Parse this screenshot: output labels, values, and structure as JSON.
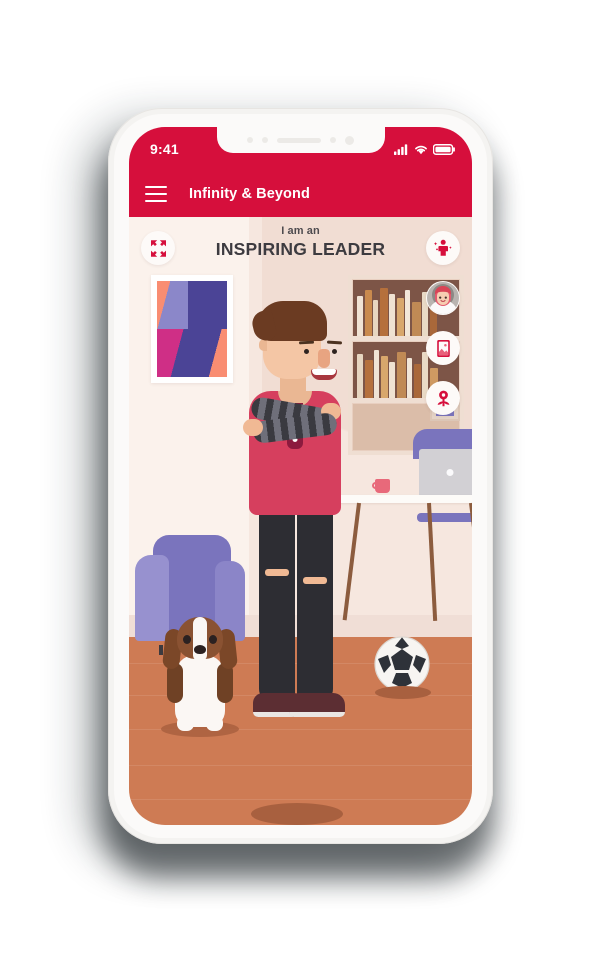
{
  "theme": {
    "brand_color": "#d60f3c",
    "screen_background": "#f7ece6",
    "floor_color": "#ce7b54",
    "wall_color": "#f6e7df",
    "accent_purple": "#7a74bd",
    "shirt_color": "#d63f5e"
  },
  "phone": {
    "frame_color": "#f4f3f1",
    "notch": {
      "name": "notch",
      "elements": [
        "sensor-dot",
        "sensor-dot",
        "speaker-slot",
        "sensor-dot",
        "camera-dot"
      ]
    }
  },
  "status_bar": {
    "time": "9:41",
    "icons": [
      "cellular-signal-icon",
      "wifi-icon",
      "battery-icon"
    ],
    "signal_bars": 4,
    "battery_level": "full"
  },
  "app_bar": {
    "menu_icon": "hamburger-menu-icon",
    "title": "Infinity & Beyond"
  },
  "header": {
    "kicker": "I am an",
    "title": "INSPIRING LEADER",
    "expand_button": {
      "icon": "expand-arrows-icon",
      "label": "Expand"
    }
  },
  "side_rail": {
    "buttons": [
      {
        "id": "avatar-style",
        "icon": "person-sparkle-icon",
        "label": "Character"
      },
      {
        "id": "character-thumb",
        "icon": "character-portrait-icon",
        "label": "Portrait"
      },
      {
        "id": "background-image",
        "icon": "photo-frame-icon",
        "label": "Background"
      },
      {
        "id": "decor-plant",
        "icon": "flower-pin-icon",
        "label": "Decor"
      }
    ]
  },
  "scene": {
    "name": "living-room-illustration",
    "description": "Illustrated man with crossed arms standing in a living room",
    "wall_art": {
      "name": "abstract-wall-art",
      "colors": [
        "#f98d72",
        "#8b87c9",
        "#4b4496",
        "#cf2f86"
      ]
    },
    "bookshelf": {
      "name": "bookshelf",
      "shelves": 3,
      "row_one": [
        {
          "w": 6,
          "h": 40,
          "color": "#f0e3d4"
        },
        {
          "w": 7,
          "h": 46,
          "color": "#c98a4e"
        },
        {
          "w": 5,
          "h": 36,
          "color": "#e7d6c1"
        },
        {
          "w": 8,
          "h": 48,
          "color": "#b5703c"
        },
        {
          "w": 6,
          "h": 42,
          "color": "#efe2d2"
        },
        {
          "w": 7,
          "h": 38,
          "color": "#d8a76c"
        },
        {
          "w": 5,
          "h": 46,
          "color": "#f2e7d9"
        },
        {
          "w": 9,
          "h": 34,
          "color": "#c08a55"
        },
        {
          "w": 6,
          "h": 44,
          "color": "#e9dac6"
        },
        {
          "w": 7,
          "h": 30,
          "color": "#a9683a"
        }
      ],
      "row_two": [
        {
          "w": 6,
          "h": 44,
          "color": "#e7d6c1"
        },
        {
          "w": 8,
          "h": 38,
          "color": "#b5703c"
        },
        {
          "w": 5,
          "h": 48,
          "color": "#f0e3d4"
        },
        {
          "w": 7,
          "h": 42,
          "color": "#d8a76c"
        },
        {
          "w": 6,
          "h": 36,
          "color": "#efe2d2"
        },
        {
          "w": 9,
          "h": 46,
          "color": "#c08a55"
        },
        {
          "w": 5,
          "h": 40,
          "color": "#f2e7d9"
        },
        {
          "w": 7,
          "h": 34,
          "color": "#a9683a"
        },
        {
          "w": 6,
          "h": 46,
          "color": "#e9dac6"
        },
        {
          "w": 8,
          "h": 30,
          "color": "#cf9a62"
        }
      ],
      "shelf_frame_color": "#7a74bd"
    },
    "desk": {
      "name": "desk",
      "top_color": "#fdfbf8",
      "leg_color": "#8c5c3e",
      "items": [
        "laptop",
        "coffee-mug"
      ]
    },
    "chair": {
      "name": "desk-chair",
      "color": "#7a74bd"
    },
    "armchair": {
      "name": "armchair",
      "color": "#7a74bd"
    },
    "dog": {
      "name": "beagle-dog",
      "body_color": "#fbf7f4",
      "fur_color": "#8a5232"
    },
    "ball": {
      "name": "soccer-ball",
      "colors": [
        "#ffffff",
        "#2e3239"
      ]
    },
    "character": {
      "name": "man-character",
      "hair_color": "#6b3b22",
      "skin_color": "#f4c6a5",
      "shirt_color": "#d63f5e",
      "sleeve_colors": [
        "#3a3a40",
        "#6f6f7a"
      ],
      "pants_color": "#2d2d33",
      "shoe_color": "#5c2e33",
      "pose": "arms-crossed"
    }
  }
}
